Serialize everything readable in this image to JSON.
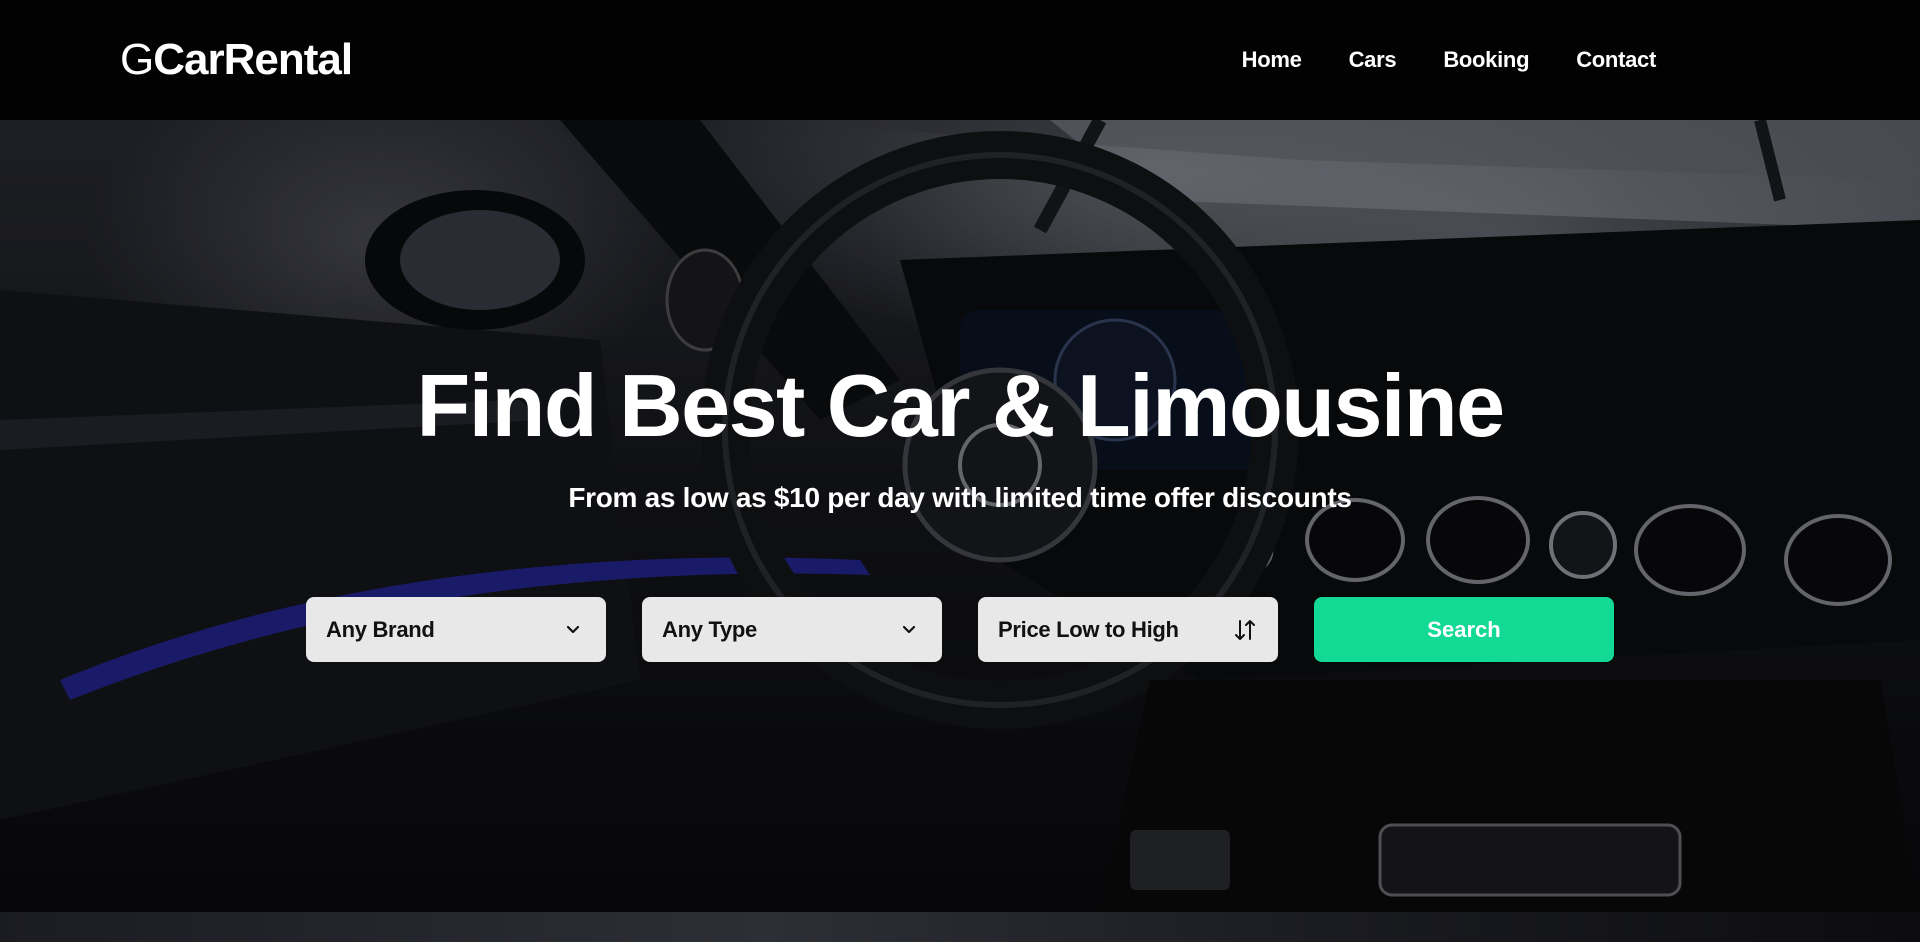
{
  "brand": {
    "logo_mark": "G",
    "logo_name": "CarRental"
  },
  "nav": {
    "items": [
      {
        "label": "Home"
      },
      {
        "label": "Cars"
      },
      {
        "label": "Booking"
      },
      {
        "label": "Contact"
      }
    ]
  },
  "hero": {
    "title": "Find Best Car & Limousine",
    "subtitle": "From as low as $10 per day with limited time offer discounts"
  },
  "filters": {
    "brand_select": {
      "value": "Any Brand",
      "icon": "chevron-down-icon"
    },
    "type_select": {
      "value": "Any Type",
      "icon": "chevron-down-icon"
    },
    "sort_select": {
      "value": "Price Low to High",
      "icon": "sort-arrows-icon"
    },
    "search_label": "Search"
  },
  "colors": {
    "header_bg": "#020202",
    "accent": "#12d993",
    "select_bg": "#e8e8e8",
    "text_light": "#ffffff"
  }
}
